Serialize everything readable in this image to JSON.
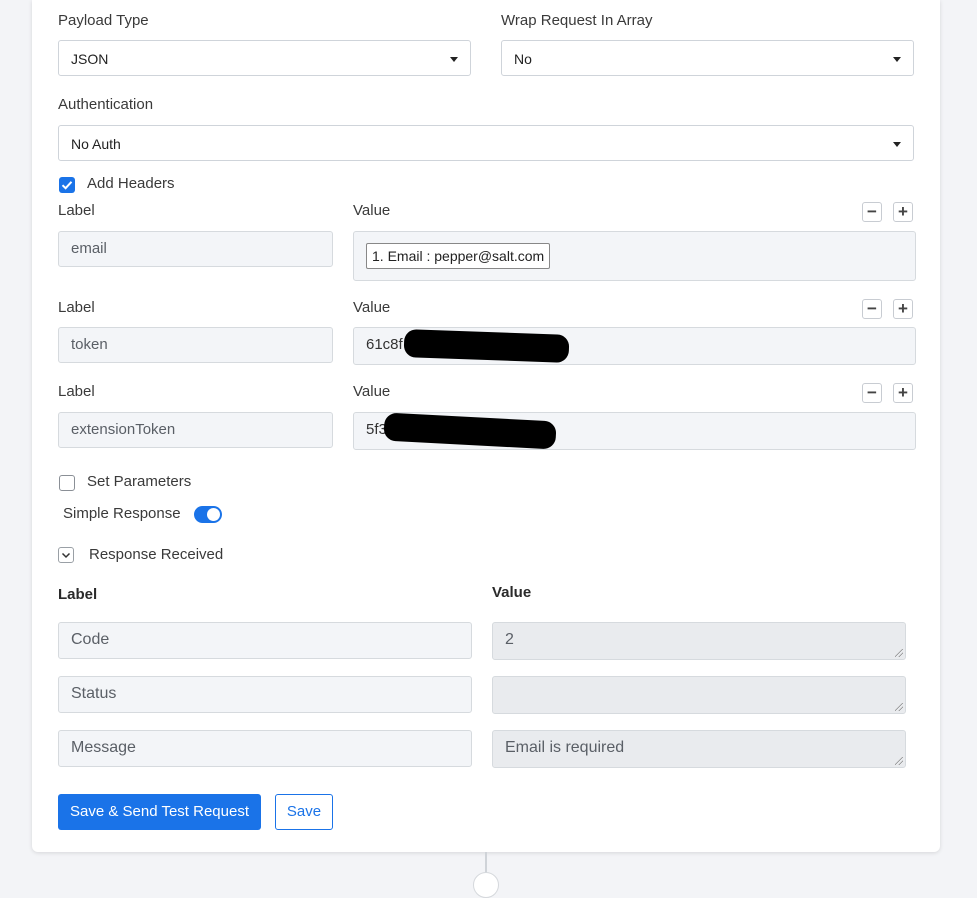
{
  "payload_type": {
    "label": "Payload Type",
    "value": "JSON"
  },
  "wrap_request": {
    "label": "Wrap Request In Array",
    "value": "No"
  },
  "authentication": {
    "label": "Authentication",
    "value": "No Auth"
  },
  "add_headers": {
    "label": "Add Headers",
    "checked": true
  },
  "headers": [
    {
      "label_heading": "Label",
      "value_heading": "Value",
      "label": "email",
      "value": "1. Email : pepper@salt.com"
    },
    {
      "label_heading": "Label",
      "value_heading": "Value",
      "label": "token",
      "value": "61c8f"
    },
    {
      "label_heading": "Label",
      "value_heading": "Value",
      "label": "extensionToken",
      "value": "5f3"
    }
  ],
  "set_parameters": {
    "label": "Set Parameters",
    "checked": false
  },
  "simple_response": {
    "label": "Simple Response",
    "on": true
  },
  "response_received": {
    "label": "Response Received"
  },
  "response_table": {
    "label_heading": "Label",
    "value_heading": "Value",
    "rows": [
      {
        "label": "Code",
        "value": "2"
      },
      {
        "label": "Status",
        "value": ""
      },
      {
        "label": "Message",
        "value": "Email is required"
      }
    ]
  },
  "buttons": {
    "save_send": "Save & Send Test Request",
    "save": "Save"
  },
  "colors": {
    "accent": "#1a73e8"
  }
}
